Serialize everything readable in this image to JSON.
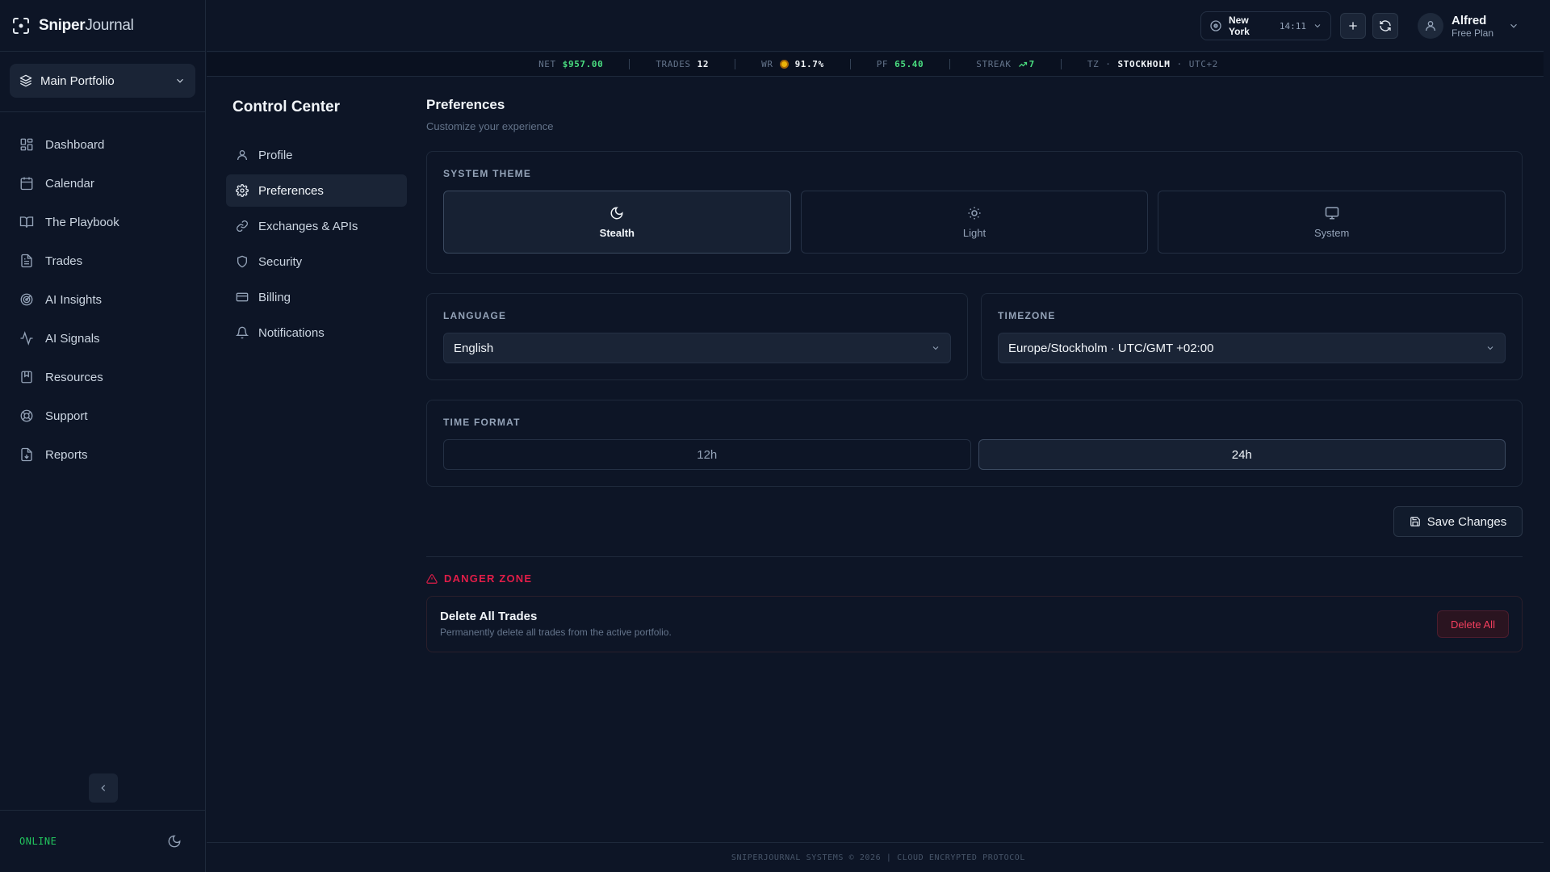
{
  "app": {
    "name_part1": "Sniper",
    "name_part2": "Journal"
  },
  "portfolio": {
    "label": "Main Portfolio"
  },
  "sidebar": {
    "items": [
      {
        "label": "Dashboard",
        "icon": "dashboard-icon"
      },
      {
        "label": "Calendar",
        "icon": "calendar-icon"
      },
      {
        "label": "The Playbook",
        "icon": "book-icon"
      },
      {
        "label": "Trades",
        "icon": "file-text-icon"
      },
      {
        "label": "AI Insights",
        "icon": "radar-icon"
      },
      {
        "label": "AI Signals",
        "icon": "activity-icon"
      },
      {
        "label": "Resources",
        "icon": "bookmark-icon"
      },
      {
        "label": "Support",
        "icon": "lifebuoy-icon"
      },
      {
        "label": "Reports",
        "icon": "file-download-icon"
      }
    ],
    "status": "ONLINE"
  },
  "topbar": {
    "clock_city": "New York",
    "clock_time": "14:11",
    "user_name": "Alfred",
    "user_plan": "Free Plan"
  },
  "ticker": {
    "net_label": "NET",
    "net_value": "$957.00",
    "trades_label": "TRADES",
    "trades_value": "12",
    "wr_label": "WR",
    "wr_value": "91.7%",
    "pf_label": "PF",
    "pf_value": "65.40",
    "streak_label": "STREAK",
    "streak_value": "7",
    "tz_label": "TZ",
    "tz_city": "STOCKHOLM",
    "tz_offset": "UTC+2"
  },
  "control_center": {
    "title": "Control Center",
    "items": [
      {
        "label": "Profile",
        "icon": "user-icon"
      },
      {
        "label": "Preferences",
        "icon": "gear-icon",
        "active": true
      },
      {
        "label": "Exchanges & APIs",
        "icon": "link-icon"
      },
      {
        "label": "Security",
        "icon": "shield-icon"
      },
      {
        "label": "Billing",
        "icon": "credit-card-icon"
      },
      {
        "label": "Notifications",
        "icon": "bell-icon"
      }
    ]
  },
  "preferences": {
    "title": "Preferences",
    "subtitle": "Customize your experience",
    "theme_label": "SYSTEM THEME",
    "themes": [
      {
        "label": "Stealth",
        "icon": "moon-icon",
        "active": true
      },
      {
        "label": "Light",
        "icon": "sun-icon",
        "active": false
      },
      {
        "label": "System",
        "icon": "monitor-icon",
        "active": false
      }
    ],
    "language_label": "LANGUAGE",
    "language_value": "English",
    "timezone_label": "TIMEZONE",
    "timezone_value": "Europe/Stockholm · UTC/GMT +02:00",
    "time_format_label": "TIME FORMAT",
    "time_formats": [
      {
        "label": "12h",
        "active": false
      },
      {
        "label": "24h",
        "active": true
      }
    ],
    "save_label": "Save Changes"
  },
  "danger_zone": {
    "title": "DANGER ZONE",
    "item_title": "Delete All Trades",
    "item_desc": "Permanently delete all trades from the active portfolio.",
    "button_label": "Delete All"
  },
  "footer": {
    "text": "SNIPERJOURNAL SYSTEMS © 2026 | CLOUD ENCRYPTED PROTOCOL"
  },
  "colors": {
    "background": "#0d1526",
    "accent_green": "#4ade80",
    "danger": "#e11d48",
    "coin": "#eab308"
  }
}
